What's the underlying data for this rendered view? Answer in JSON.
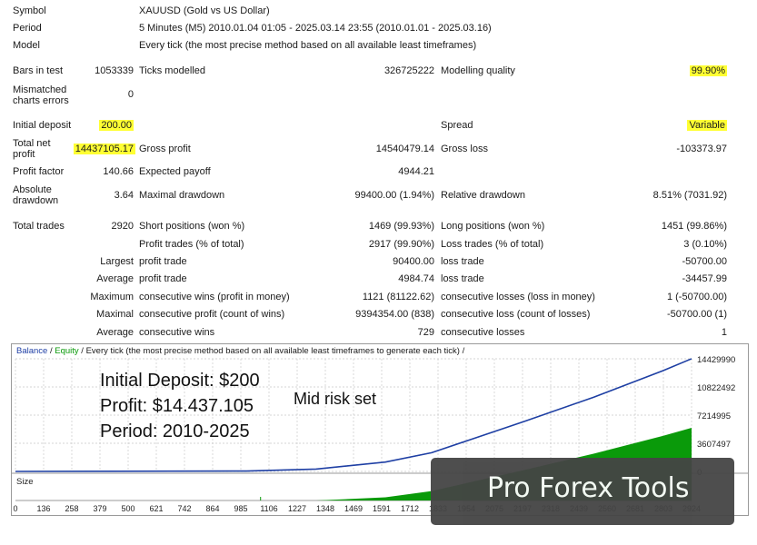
{
  "header": {
    "symbol_label": "Symbol",
    "symbol_value": "XAUUSD (Gold vs US Dollar)",
    "period_label": "Period",
    "period_value": "5 Minutes (M5) 2010.01.04 01:05 - 2025.03.14 23:55 (2010.01.01 - 2025.03.16)",
    "model_label": "Model",
    "model_value": "Every tick (the most precise method based on all available least timeframes)"
  },
  "stats": {
    "bars_label": "Bars in test",
    "bars_value": "1053339",
    "ticks_label": "Ticks modelled",
    "ticks_value": "326725222",
    "quality_label": "Modelling quality",
    "quality_value": "99.90%",
    "mismatched_label": "Mismatched charts errors",
    "mismatched_value": "0",
    "deposit_label": "Initial deposit",
    "deposit_value": "200.00",
    "spread_label": "Spread",
    "spread_value": "Variable",
    "netprofit_label": "Total net profit",
    "netprofit_value": "14437105.17",
    "grossprofit_label": "Gross profit",
    "grossprofit_value": "14540479.14",
    "grossloss_label": "Gross loss",
    "grossloss_value": "-103373.97",
    "pf_label": "Profit factor",
    "pf_value": "140.66",
    "ep_label": "Expected payoff",
    "ep_value": "4944.21",
    "absdd_label": "Absolute drawdown",
    "absdd_value": "3.64",
    "maxdd_label": "Maximal drawdown",
    "maxdd_value": "99400.00 (1.94%)",
    "reldd_label": "Relative drawdown",
    "reldd_value": "8.51% (7031.92)",
    "trades_label": "Total trades",
    "trades_value": "2920",
    "short_label": "Short positions (won %)",
    "short_value": "1469 (99.93%)",
    "long_label": "Long positions (won %)",
    "long_value": "1451 (99.86%)",
    "pt_label": "Profit trades (% of total)",
    "pt_value": "2917 (99.90%)",
    "lt_label": "Loss trades (% of total)",
    "lt_value": "3 (0.10%)",
    "largest_label": "Largest",
    "largest_pt_label": "profit trade",
    "largest_pt_value": "90400.00",
    "largest_lt_label": "loss trade",
    "largest_lt_value": "-50700.00",
    "average_label": "Average",
    "average_pt_label": "profit trade",
    "average_pt_value": "4984.74",
    "average_lt_label": "loss trade",
    "average_lt_value": "-34457.99",
    "maximum_label": "Maximum",
    "max_cw_label": "consecutive wins (profit in money)",
    "max_cw_value": "1121 (81122.62)",
    "max_cl_label": "consecutive losses (loss in money)",
    "max_cl_value": "1 (-50700.00)",
    "maximal_label": "Maximal",
    "mxl_cp_label": "consecutive profit (count of wins)",
    "mxl_cp_value": "9394354.00 (838)",
    "mxl_cl_label": "consecutive loss (count of losses)",
    "mxl_cl_value": "-50700.00 (1)",
    "avg2_label": "Average",
    "avg_cw_label": "consecutive wins",
    "avg_cw_value": "729",
    "avg_cl_label": "consecutive losses",
    "avg_cl_value": "1"
  },
  "chart": {
    "legend_balance": "Balance",
    "legend_sep1": " / ",
    "legend_equity": "Equity",
    "legend_rest": " / Every tick (the most precise method based on all available least timeframes to generate each tick) /",
    "size_label": "Size",
    "overlay_deposit": "Initial Deposit: $200",
    "overlay_profit": "Profit: $14.437.105",
    "overlay_period": "Period: 2010-2025",
    "overlay_risk": "Mid risk set",
    "brand": "Pro Forex Tools",
    "balance_color": "#1f3fa5",
    "equity_color": "#0a9a0a"
  },
  "chart_data": {
    "type": "line",
    "y_ticks": [
      "14429990",
      "10822492",
      "7214995",
      "3607497",
      "0"
    ],
    "x_ticks": [
      "0",
      "136",
      "258",
      "379",
      "500",
      "621",
      "742",
      "864",
      "985",
      "1106",
      "1227",
      "1348",
      "1469",
      "1591",
      "1712",
      "1833",
      "1954",
      "2075",
      "2197",
      "2318",
      "2439",
      "2560",
      "2681",
      "2803",
      "2924"
    ],
    "x": [
      0,
      1000,
      1300,
      1600,
      1800,
      1950,
      2200,
      2500,
      2800,
      2924
    ],
    "series": [
      {
        "values": [
          200,
          50000,
          300000,
          1200000,
          2400000,
          3900000,
          6400000,
          9500000,
          12900000,
          14437105
        ]
      }
    ],
    "xlim": [
      0,
      2924
    ],
    "ylim": [
      0,
      14429990
    ]
  }
}
